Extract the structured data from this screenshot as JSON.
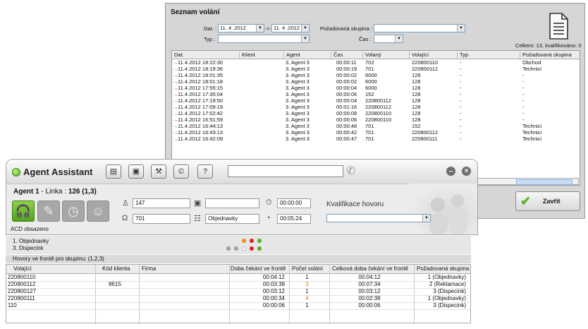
{
  "call_list": {
    "title": "Seznam volání",
    "date_label": "Dat. :",
    "date_from": "11. 4 .2012",
    "date_sep": "->",
    "date_to": "11. 4 .2012",
    "group_label": "Požadovaná skupina :",
    "group_value": "",
    "type_label": "Typ :",
    "type_value": "",
    "time_label": "Čas :",
    "time_value": "",
    "total": "Celkem: 13, kvalifikováno: 0",
    "columns": [
      "Dat.",
      "Klient",
      "Agent",
      "Čas",
      "Volaný",
      "Volající",
      "Typ",
      "Požadovaná skupina"
    ],
    "rows": [
      {
        "dir": "in",
        "date": "11.4.2012 18:22:30",
        "client": "",
        "agent": "3. Agent 3",
        "time": "00:00:11",
        "called": "702",
        "caller": "220800110",
        "type": "-",
        "group": "Obchod"
      },
      {
        "dir": "in",
        "date": "11.4.2012 18:19:36",
        "client": "",
        "agent": "3. Agent 3",
        "time": "00:00:19",
        "called": "701",
        "caller": "220800112",
        "type": "-",
        "group": "Technici"
      },
      {
        "dir": "out",
        "date": "11.4.2012 18:01:35",
        "client": "",
        "agent": "3. Agent 3",
        "time": "00:00:02",
        "called": "6000",
        "caller": "128",
        "type": "-",
        "group": "-"
      },
      {
        "dir": "out",
        "date": "11.4.2012 18:01:18",
        "client": "",
        "agent": "3. Agent 3",
        "time": "00:00:02",
        "called": "6000",
        "caller": "128",
        "type": "-",
        "group": "-"
      },
      {
        "dir": "out",
        "date": "11.4.2012 17:55:15",
        "client": "",
        "agent": "3. Agent 3",
        "time": "00:00:04",
        "called": "6000",
        "caller": "128",
        "type": "-",
        "group": "-"
      },
      {
        "dir": "out",
        "date": "11.4.2012 17:35:04",
        "client": "",
        "agent": "3. Agent 3",
        "time": "00:00:06",
        "called": "152",
        "caller": "128",
        "type": "-",
        "group": "-"
      },
      {
        "dir": "out",
        "date": "11.4.2012 17:19:50",
        "client": "",
        "agent": "3. Agent 3",
        "time": "00:00:04",
        "called": "220800112",
        "caller": "128",
        "type": "-",
        "group": "-"
      },
      {
        "dir": "out",
        "date": "11.4.2012 17:09:19",
        "client": "",
        "agent": "3. Agent 3",
        "time": "00:01:16",
        "called": "220800112",
        "caller": "128",
        "type": "-",
        "group": "-"
      },
      {
        "dir": "out",
        "date": "11.4.2012 17:02:42",
        "client": "",
        "agent": "3. Agent 3",
        "time": "00:00:08",
        "called": "220800110",
        "caller": "128",
        "type": "-",
        "group": "-"
      },
      {
        "dir": "out",
        "date": "11.4.2012 16:51:59",
        "client": "",
        "agent": "3. Agent 3",
        "time": "00:00:06",
        "called": "220800110",
        "caller": "128",
        "type": "-",
        "group": "-"
      },
      {
        "dir": "in",
        "date": "11.4.2012 16:44:13",
        "client": "",
        "agent": "3. Agent 3",
        "time": "00:00:48",
        "called": "701",
        "caller": "152",
        "type": "-",
        "group": "Technici"
      },
      {
        "dir": "in",
        "date": "11.4.2012 16:43:13",
        "client": "",
        "agent": "3. Agent 3",
        "time": "00:00:42",
        "called": "701",
        "caller": "220800112",
        "type": "-",
        "group": "Technici"
      },
      {
        "dir": "in",
        "date": "11.4.2012 16:42:09",
        "client": "",
        "agent": "3. Agent 3",
        "time": "00:00:47",
        "called": "701",
        "caller": "220800111",
        "type": "-",
        "group": "Technici"
      }
    ],
    "close_label": "Zavřít"
  },
  "agent_window": {
    "title": "Agent Assistant",
    "agent_name": "Agent 1",
    "line_label": " - Linka : ",
    "line_value": "126 (1,3)",
    "status": "ACD obsazeno",
    "fields": {
      "caller_id": "147",
      "client_card": "",
      "duration": "00:00:00",
      "line": "701",
      "group": "Objednavky",
      "wait": "00:05:24"
    },
    "qualification_label": "Kvalifikace hovoru",
    "qualification_value": ""
  },
  "groups": [
    {
      "label": "1. Objednavky"
    },
    {
      "label": "3. Dispecink"
    }
  ],
  "queue": {
    "title": "Hovory ve frontě pro skupinu: (1,2,3)",
    "columns": [
      "Volající",
      "Kód klienta",
      "Firma",
      "Doba čekání ve frontě",
      "Počet volání",
      "Celková doba čekání ve frontě",
      "Požadovaná skupina"
    ],
    "rows": [
      {
        "caller": "220800110",
        "code": "",
        "firm": "",
        "wait": "00:04:12",
        "count": "1",
        "total": "00:04:12",
        "group": "1 (Objednavky)",
        "hot": false
      },
      {
        "caller": "220800112",
        "code": "8615",
        "firm": "",
        "wait": "00:03:38",
        "count": "3",
        "total": "00:07:34",
        "group": "2 (Reklamace)",
        "hot": true
      },
      {
        "caller": "220800127",
        "code": "",
        "firm": "",
        "wait": "00:03:12",
        "count": "1",
        "total": "00:03:12",
        "group": "3 (Dispecink)",
        "hot": false
      },
      {
        "caller": "220800111",
        "code": "",
        "firm": "",
        "wait": "00:00:34",
        "count": "4",
        "total": "00:02:38",
        "group": "1 (Objednavky)",
        "hot": true
      },
      {
        "caller": "110",
        "code": "",
        "firm": "",
        "wait": "00:00:06",
        "count": "1",
        "total": "00:00:06",
        "group": "3 (Dispecink)",
        "hot": false
      }
    ]
  },
  "colors": {
    "accent_green": "#4fae1a",
    "count_orange": "#e07b00",
    "incoming_arrow": "#2e8b2e",
    "outgoing_arrow": "#c02020"
  }
}
